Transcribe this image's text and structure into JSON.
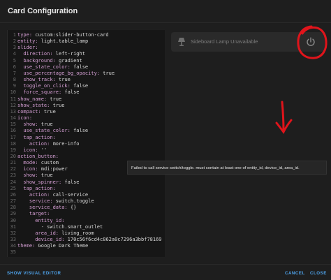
{
  "dialog": {
    "title": "Card Configuration"
  },
  "editor": {
    "lines": [
      {
        "n": "1",
        "k": "type:",
        "v": " custom:slider-button-card"
      },
      {
        "n": "2",
        "k": "entity:",
        "v": " light.table_lamp"
      },
      {
        "n": "3",
        "k": "slider:",
        "v": ""
      },
      {
        "n": "4",
        "k": "  direction:",
        "v": " left-right"
      },
      {
        "n": "5",
        "k": "  background:",
        "v": " gradient"
      },
      {
        "n": "6",
        "k": "  use_state_color:",
        "v": " false"
      },
      {
        "n": "7",
        "k": "  use_percentage_bg_opacity:",
        "v": " true"
      },
      {
        "n": "8",
        "k": "  show_track:",
        "v": " true"
      },
      {
        "n": "9",
        "k": "  toggle_on_click:",
        "v": " false"
      },
      {
        "n": "10",
        "k": "  force_square:",
        "v": " false"
      },
      {
        "n": "11",
        "k": "show_name:",
        "v": " true"
      },
      {
        "n": "12",
        "k": "show_state:",
        "v": " true"
      },
      {
        "n": "13",
        "k": "compact:",
        "v": " true"
      },
      {
        "n": "14",
        "k": "icon:",
        "v": ""
      },
      {
        "n": "15",
        "k": "  show:",
        "v": " true"
      },
      {
        "n": "16",
        "k": "  use_state_color:",
        "v": " false"
      },
      {
        "n": "17",
        "k": "  tap_action:",
        "v": ""
      },
      {
        "n": "18",
        "k": "    action:",
        "v": " more-info"
      },
      {
        "n": "19",
        "k": "  icon:",
        "v": " ''"
      },
      {
        "n": "20",
        "k": "action_button:",
        "v": ""
      },
      {
        "n": "21",
        "k": "  mode:",
        "v": " custom"
      },
      {
        "n": "22",
        "k": "  icon:",
        "v": " mdi:power"
      },
      {
        "n": "23",
        "k": "  show:",
        "v": " true"
      },
      {
        "n": "24",
        "k": "  show_spinner:",
        "v": " false"
      },
      {
        "n": "25",
        "k": "  tap_action:",
        "v": ""
      },
      {
        "n": "26",
        "k": "    action:",
        "v": " call-service"
      },
      {
        "n": "27",
        "k": "    service:",
        "v": " switch.toggle"
      },
      {
        "n": "28",
        "k": "    service_data:",
        "v": " {}"
      },
      {
        "n": "29",
        "k": "    target:",
        "v": ""
      },
      {
        "n": "30",
        "k": "      entity_id:",
        "v": ""
      },
      {
        "n": "31",
        "k": "",
        "v": "        - switch.smart_outlet"
      },
      {
        "n": "32",
        "k": "      area_id:",
        "v": " living_room"
      },
      {
        "n": "33",
        "k": "      device_id:",
        "v": " 170c56f6cd4c862a0c7296a3bbf78169"
      },
      {
        "n": "34",
        "k": "theme:",
        "v": " Google Dark Theme"
      },
      {
        "n": "35",
        "k": "",
        "v": ""
      }
    ]
  },
  "preview": {
    "label": "Sideboard Lamp Unavailable",
    "lamp_icon": "lamp-icon",
    "power_icon": "power-icon"
  },
  "toast": {
    "message": "Failed to call service switch/toggle. must contain at least one of entity_id, device_id, area_id."
  },
  "footer": {
    "show_visual_editor": "SHOW VISUAL EDITOR",
    "cancel": "CANCEL",
    "close": "CLOSE"
  },
  "colors": {
    "accent": "#4ea1e8",
    "annotation_red": "#e0141b",
    "yaml_key": "#d59fd4"
  }
}
